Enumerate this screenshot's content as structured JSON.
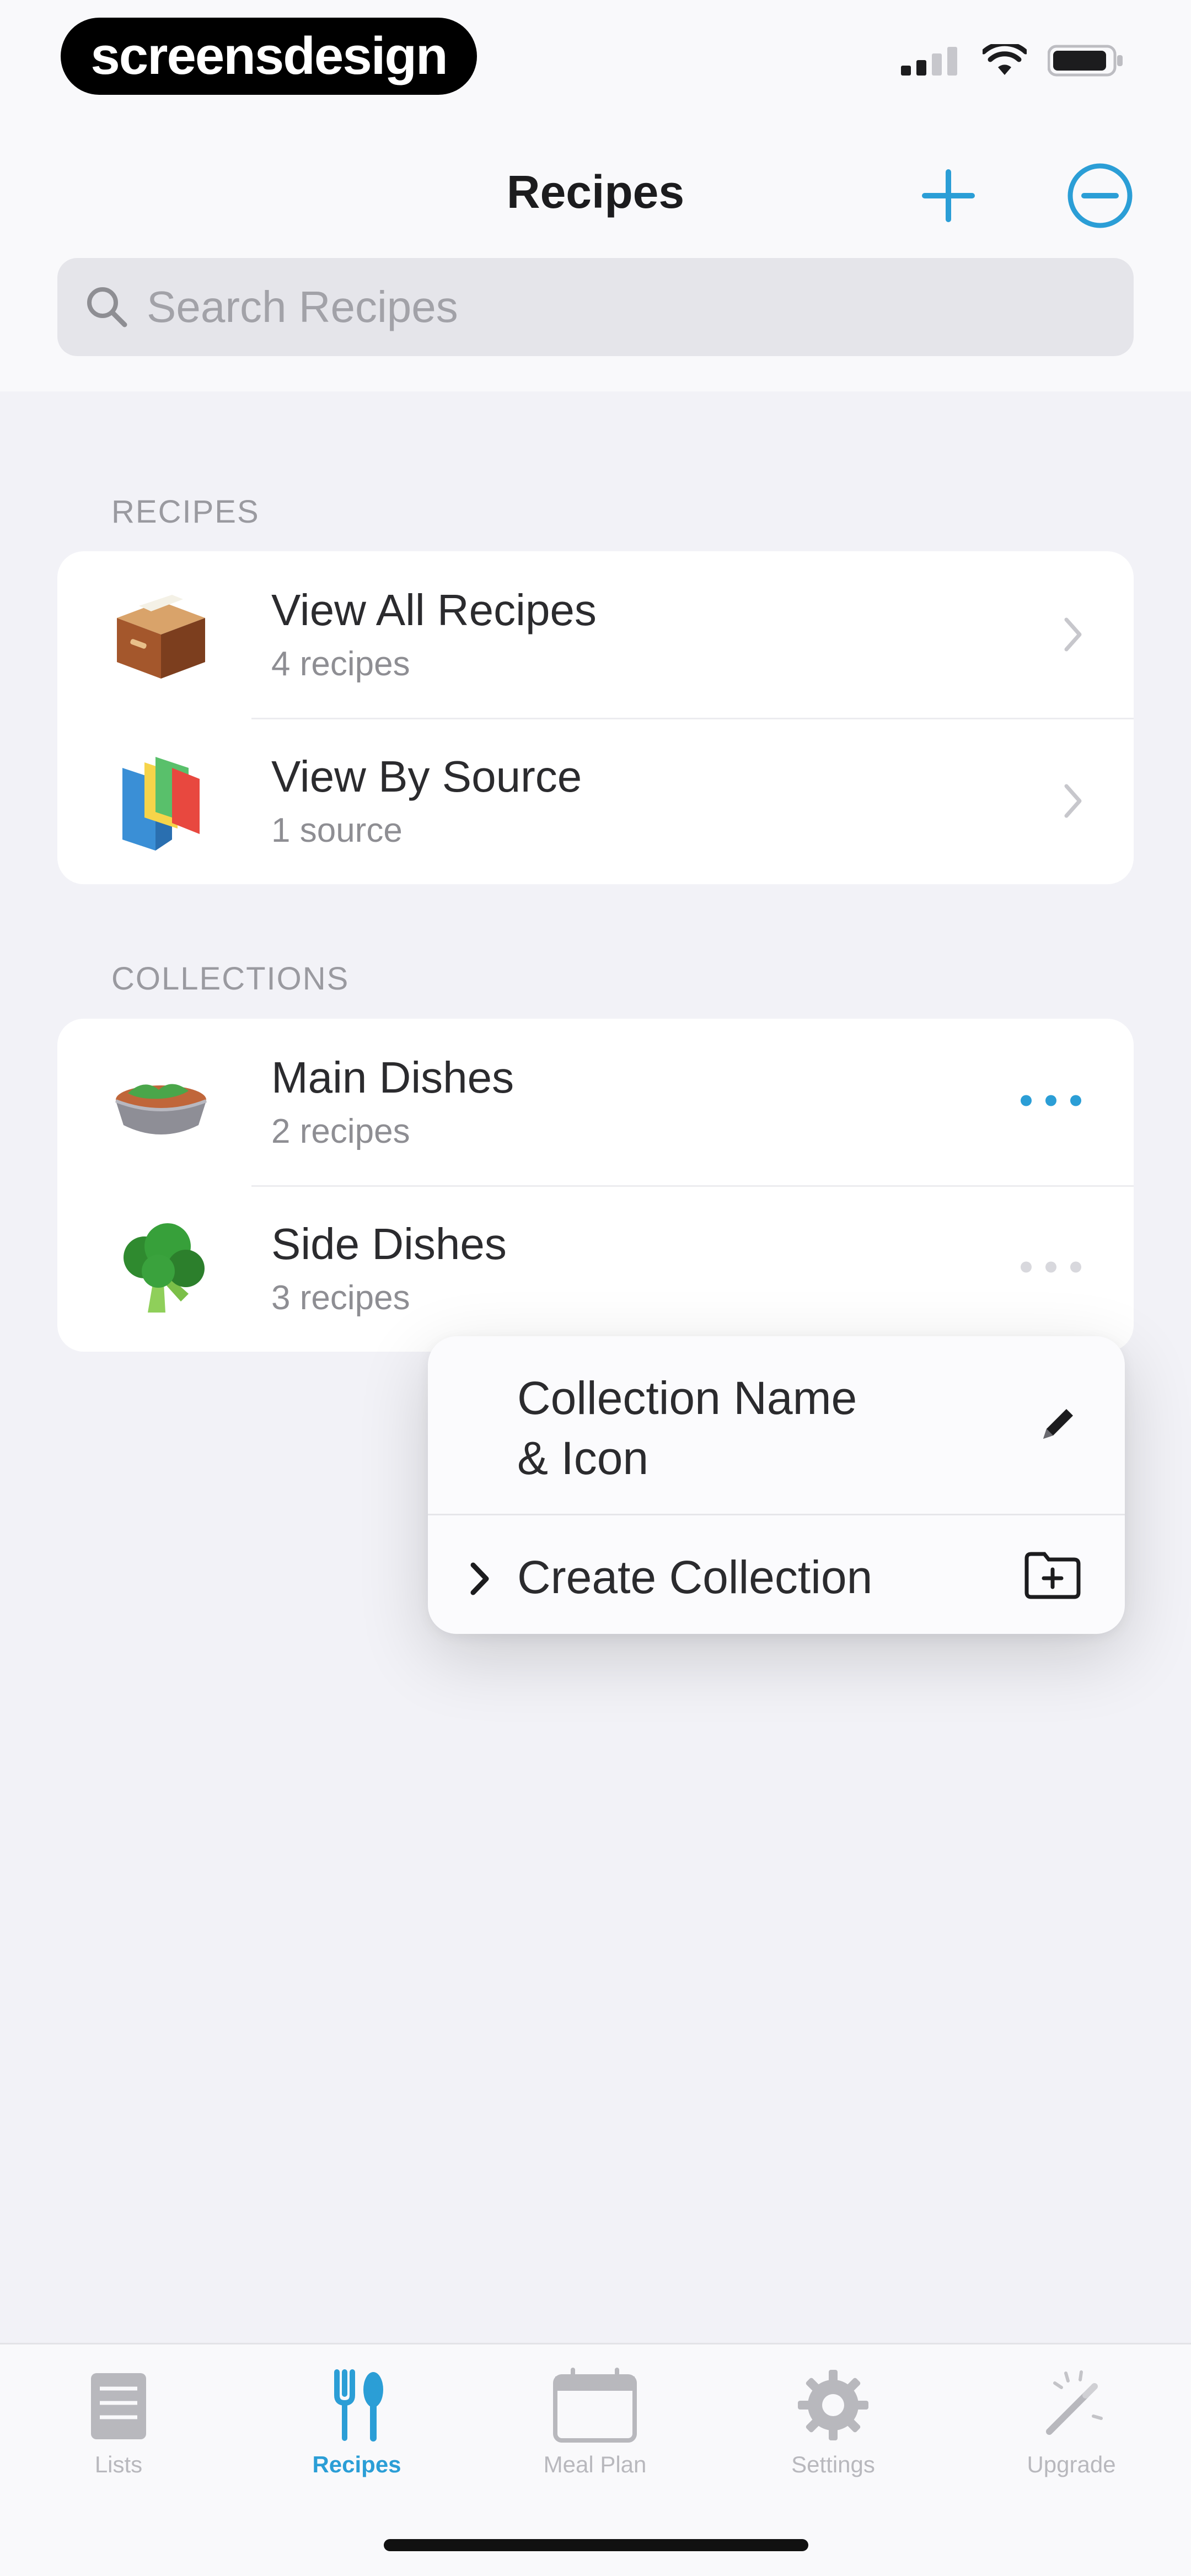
{
  "status_bar": {
    "brand": "screensdesign"
  },
  "header": {
    "title": "Recipes",
    "search_placeholder": "Search Recipes",
    "add_icon": "plus-icon",
    "edit_icon": "minus-circle-icon"
  },
  "recipes_section": {
    "header": "RECIPES",
    "items": [
      {
        "title": "View All Recipes",
        "subtitle": "4 recipes",
        "icon": "recipe-box-icon"
      },
      {
        "title": "View By Source",
        "subtitle": "1 source",
        "icon": "books-icon"
      }
    ]
  },
  "collections_section": {
    "header": "COLLECTIONS",
    "items": [
      {
        "title": "Main Dishes",
        "subtitle": "2 recipes",
        "icon": "bowl-icon"
      },
      {
        "title": "Side Dishes",
        "subtitle": "3 recipes",
        "icon": "broccoli-icon"
      }
    ]
  },
  "context_menu": {
    "items": [
      {
        "label_line1": "Collection Name",
        "label_line2": "& Icon",
        "icon": "pencil-icon"
      },
      {
        "label": "Create Collection",
        "icon": "folder-plus-icon"
      }
    ]
  },
  "tab_bar": {
    "tabs": [
      {
        "label": "Lists",
        "icon": "list-icon"
      },
      {
        "label": "Recipes",
        "icon": "fork-spoon-icon",
        "active": true
      },
      {
        "label": "Meal Plan",
        "icon": "calendar-icon"
      },
      {
        "label": "Settings",
        "icon": "gear-icon"
      },
      {
        "label": "Upgrade",
        "icon": "magic-wand-icon"
      }
    ]
  },
  "colors": {
    "accent": "#2b9ed6",
    "background": "#f2f2f7",
    "card": "#ffffff"
  }
}
